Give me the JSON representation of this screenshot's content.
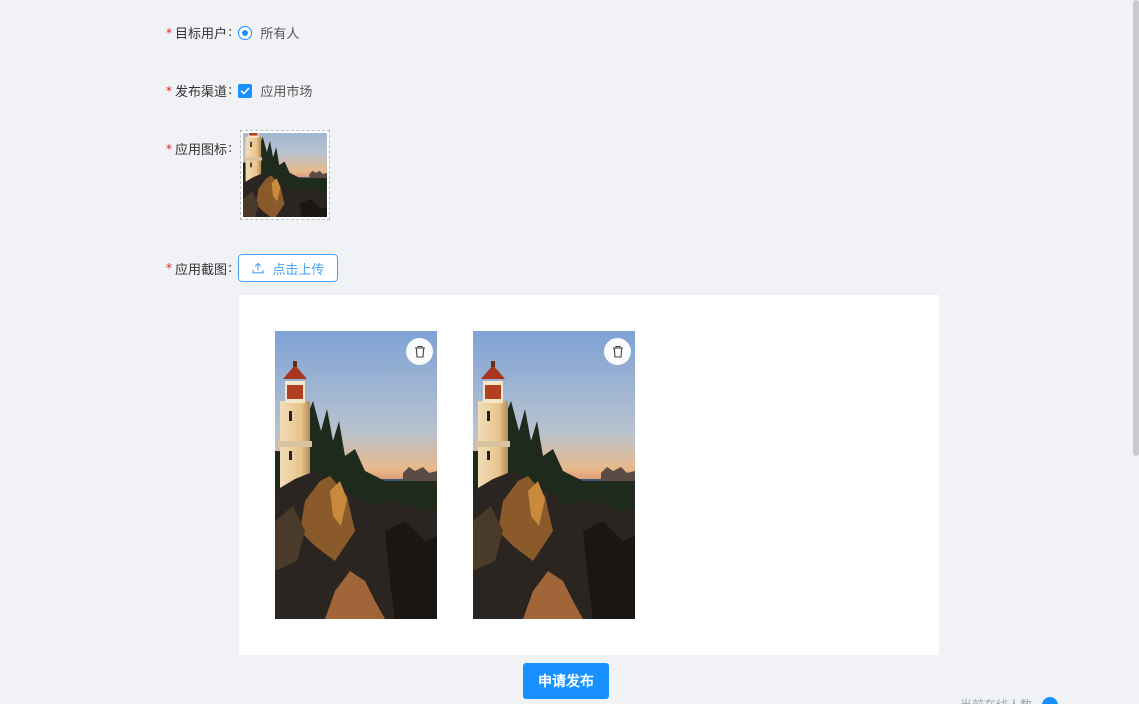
{
  "form": {
    "target_users": {
      "label": "目标用户",
      "option": "所有人",
      "selected": true
    },
    "channel": {
      "label": "发布渠道",
      "option": "应用市场",
      "checked": true
    },
    "app_icon": {
      "label": "应用图标"
    },
    "screenshots": {
      "label": "应用截图",
      "upload_label": "点击上传",
      "count": 2
    }
  },
  "submit_label": "申请发布",
  "footer_hint": "当前在线人数",
  "colors": {
    "primary": "#1890ff",
    "required": "#e02020",
    "background": "#f0f2f5"
  },
  "icons": [
    "upload-icon",
    "trash-icon",
    "check-icon"
  ]
}
